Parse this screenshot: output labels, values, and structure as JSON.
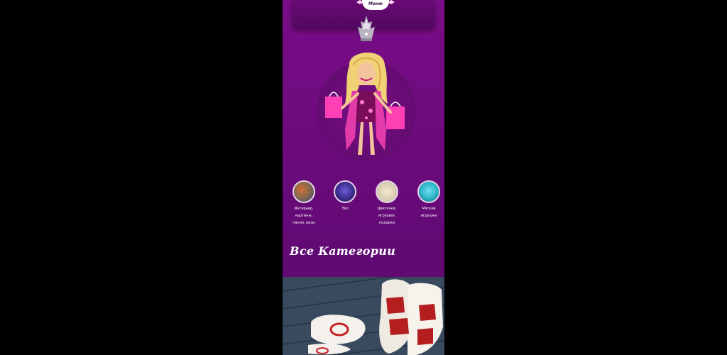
{
  "header": {
    "menu_label": "Меню"
  },
  "categories": [
    {
      "label": "Интерьер, картины,\nпанно, вазы",
      "thumb_color": "#8a6b4a",
      "icon": "interior-thumb"
    },
    {
      "label": "Эко",
      "thumb_color": "#3b2d8c",
      "icon": "flowers-thumb"
    },
    {
      "label": "Цветочки, игрушки,\nподарки",
      "thumb_color": "#d9cdb2",
      "icon": "crafts-thumb"
    },
    {
      "label": "Мягкие\nигрушки",
      "thumb_color": "#2ab3c7",
      "icon": "toys-thumb"
    }
  ],
  "all_categories_title": "Все Категории",
  "colors": {
    "accent_purple": "#7a0d88",
    "pink": "#ff3fb4",
    "white": "#ffffff"
  }
}
